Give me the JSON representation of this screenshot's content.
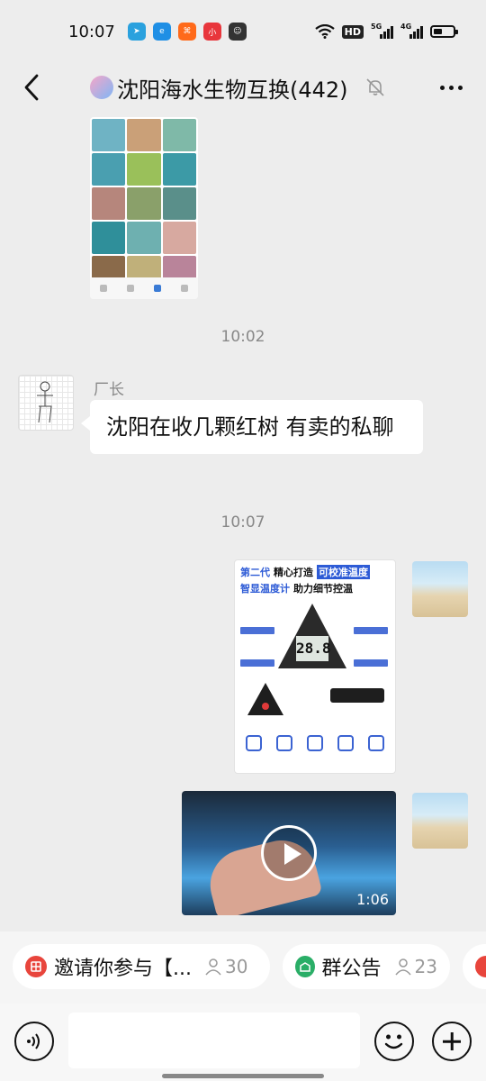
{
  "status_bar": {
    "time": "10:07",
    "apps": [
      {
        "icon": "telegram-icon",
        "color": "#2aa1de",
        "glyph": "➤"
      },
      {
        "icon": "edge-browser-icon",
        "color": "#1f8fe5",
        "glyph": "e"
      },
      {
        "icon": "orange-app-icon",
        "color": "#ff6a1a",
        "glyph": "⌘"
      },
      {
        "icon": "red-badge-app-icon",
        "color": "#e8363c",
        "glyph": "小"
      },
      {
        "icon": "robot-app-icon",
        "color": "#333333",
        "glyph": "☺"
      }
    ],
    "hd": "HD",
    "net1": "5G",
    "net2": "4G"
  },
  "header": {
    "title": "沈阳海水生物互换(442)"
  },
  "messages": {
    "time1": "10:02",
    "sender": "厂长",
    "text": "沈阳在收几颗红树 有卖的私聊",
    "time2": "10:07",
    "product": {
      "line1a": "第二代",
      "line1b": "精心打造",
      "line1c": "可校准温度",
      "line2a": "智显温度计",
      "line2b": "助力细节控温",
      "screen": "28.8"
    },
    "video_duration": "1:06"
  },
  "pinned": [
    {
      "text": "邀请你参与【...",
      "count": "30",
      "icon": "invite-icon",
      "color": "#e8453c"
    },
    {
      "text": "群公告",
      "count": "23",
      "icon": "announcement-icon",
      "color": "#2aae67"
    }
  ],
  "colors": {
    "background": "#ededed",
    "accent_blue": "#2d5bd6"
  }
}
